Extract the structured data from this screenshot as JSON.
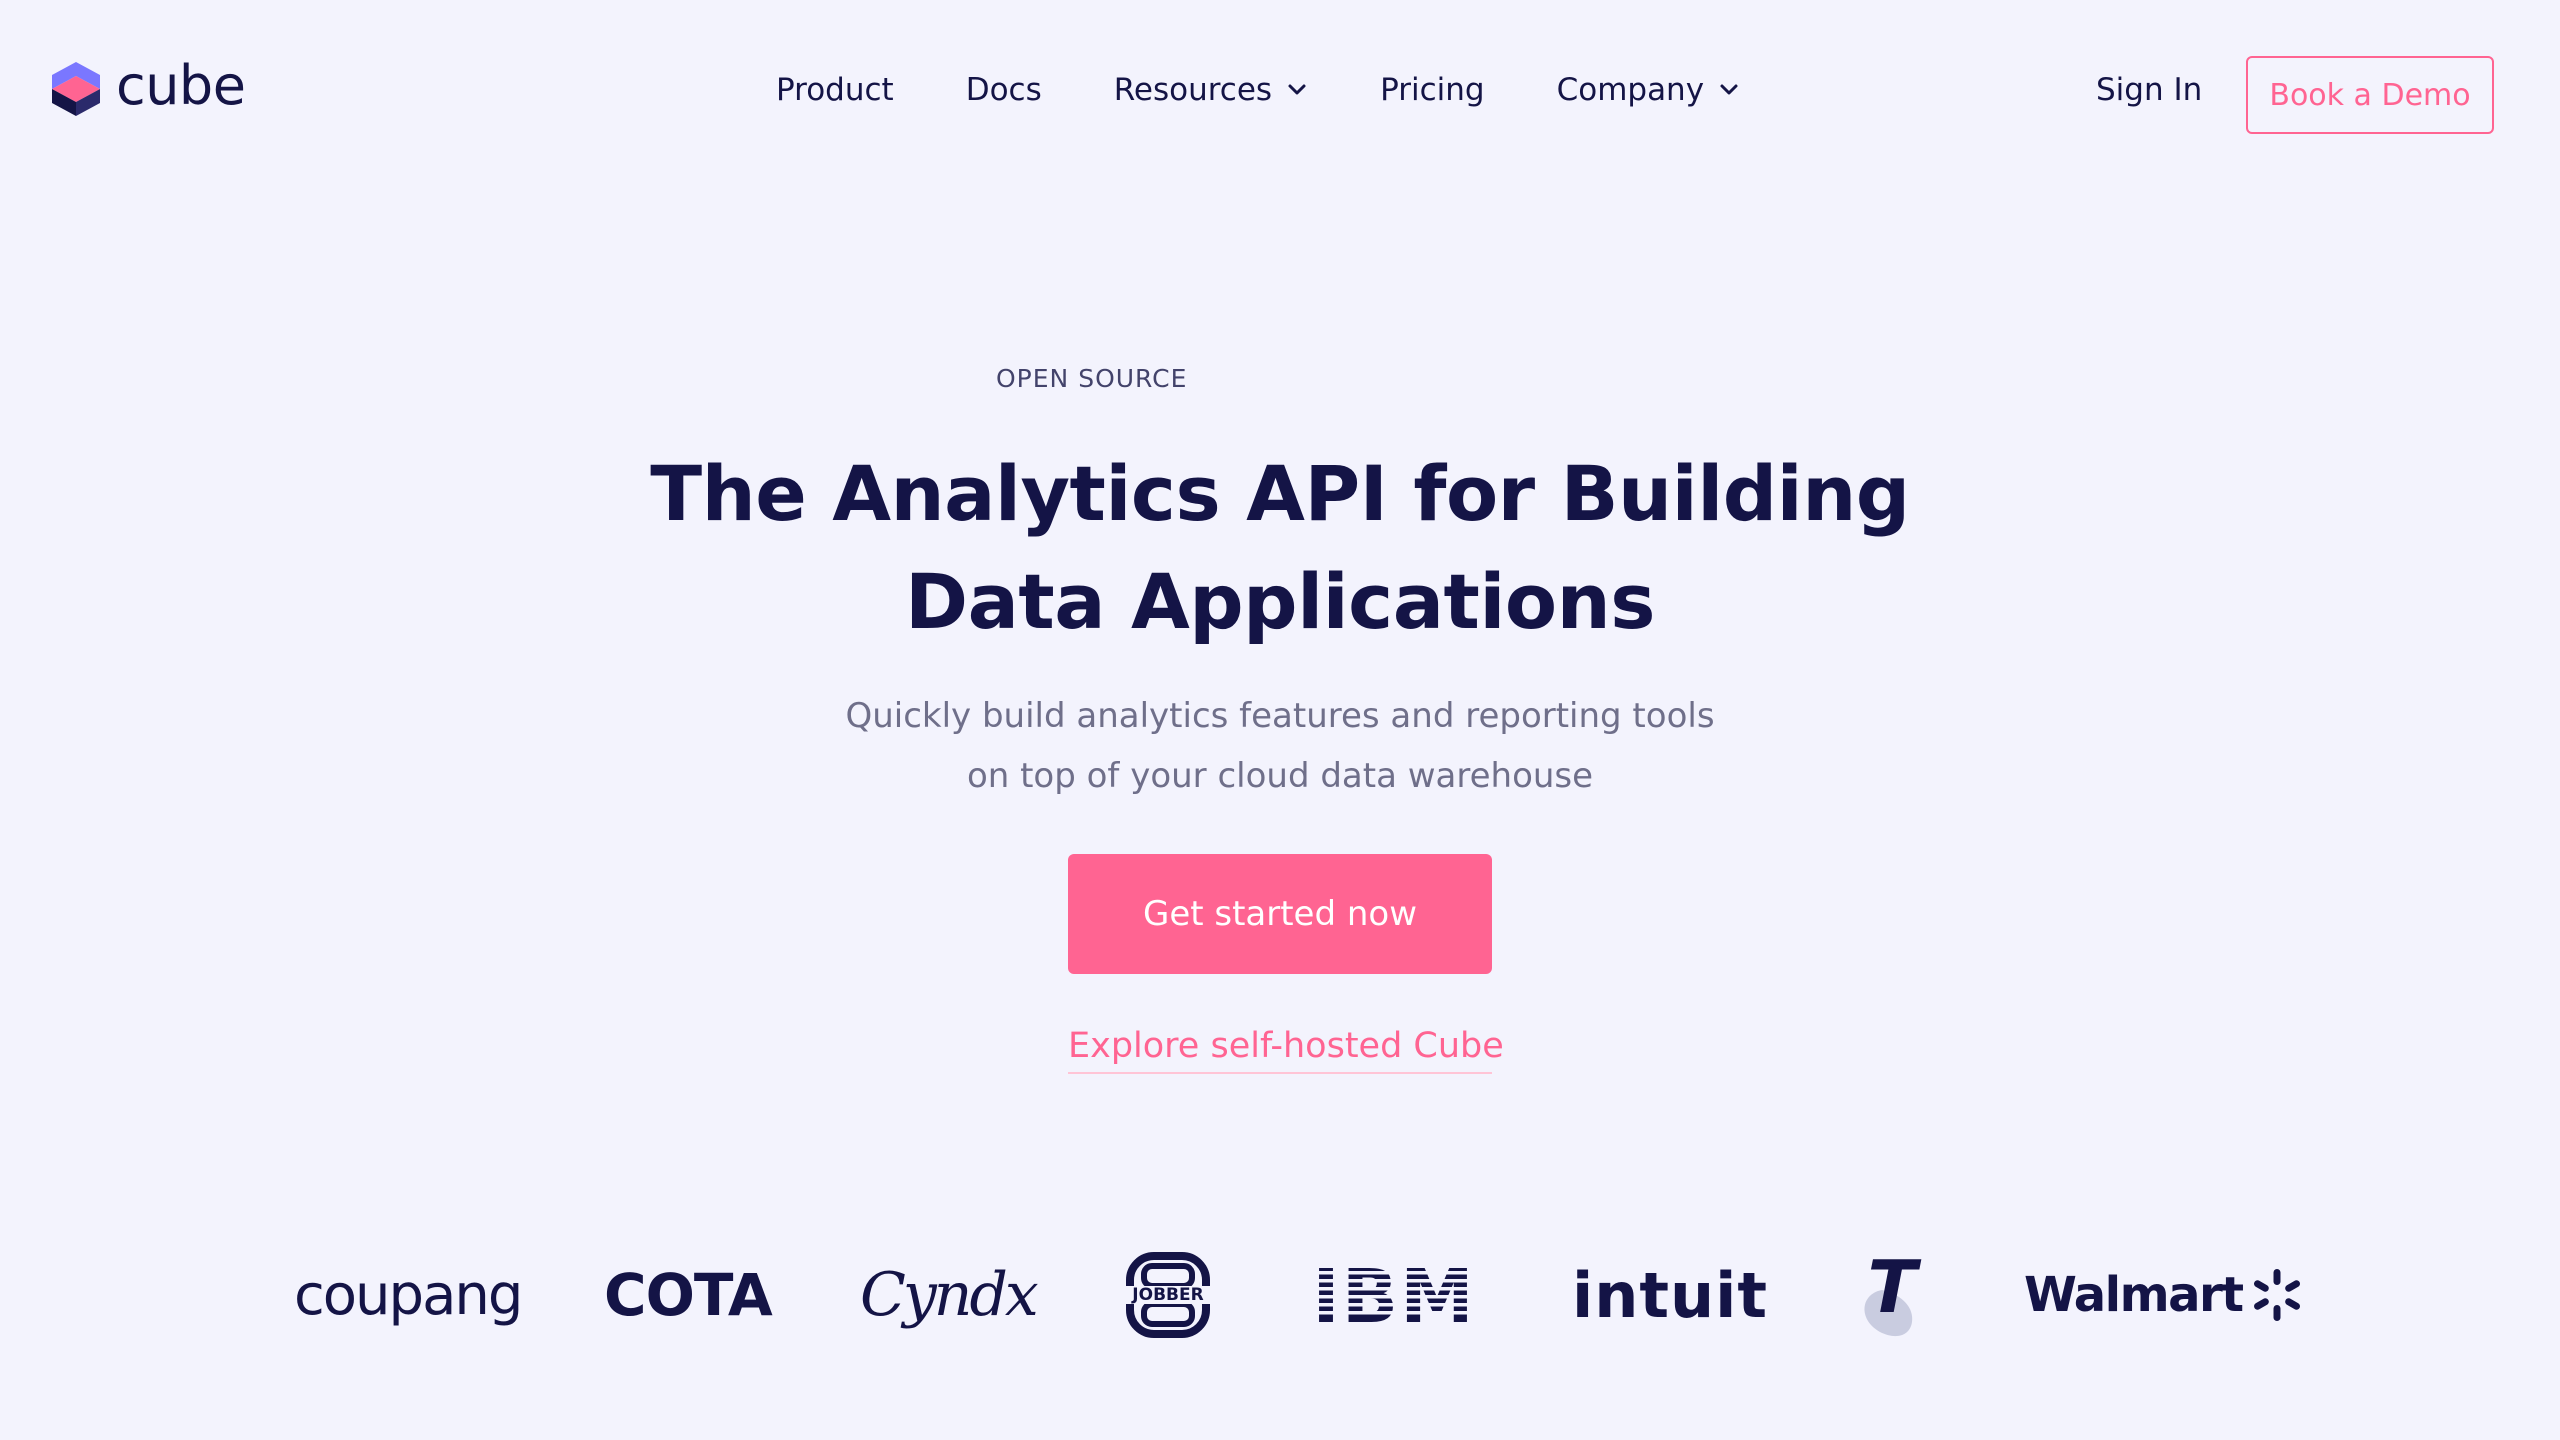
{
  "header": {
    "logo_text": "cube",
    "nav": [
      {
        "label": "Product",
        "has_dropdown": false
      },
      {
        "label": "Docs",
        "has_dropdown": false
      },
      {
        "label": "Resources",
        "has_dropdown": true
      },
      {
        "label": "Pricing",
        "has_dropdown": false
      },
      {
        "label": "Company",
        "has_dropdown": true
      }
    ],
    "sign_in_label": "Sign In",
    "book_demo_label": "Book a Demo"
  },
  "hero": {
    "eyebrow": "OPEN SOURCE",
    "title_lines": [
      "The Analytics API for Building",
      "Data Applications"
    ],
    "subtitle_lines": [
      "Quickly build analytics features and reporting tools",
      "on top of your cloud data warehouse"
    ],
    "cta_label": "Get started now",
    "secondary_link_label": "Explore self-hosted Cube"
  },
  "customers": {
    "logos": [
      {
        "name": "coupang",
        "text": "coupang"
      },
      {
        "name": "cota",
        "text": "COTA"
      },
      {
        "name": "cyndx",
        "text": "Cyndx"
      },
      {
        "name": "jobber",
        "text": "JOBBER"
      },
      {
        "name": "ibm",
        "text": "IBM"
      },
      {
        "name": "intuit",
        "text": "intuit"
      },
      {
        "name": "telstra",
        "text": "T"
      },
      {
        "name": "walmart",
        "text": "Walmart"
      }
    ]
  },
  "colors": {
    "background": "#f3f3fd",
    "text_dark": "#141446",
    "text_muted": "#6f6f8a",
    "accent_pink": "#ff6492",
    "logo_purple": "#7a77ff",
    "logo_pink": "#ff6492"
  },
  "icons": {
    "logo": "cube-logo-icon",
    "dropdown": "chevron-down-icon",
    "walmart_spark": "walmart-spark-icon"
  }
}
